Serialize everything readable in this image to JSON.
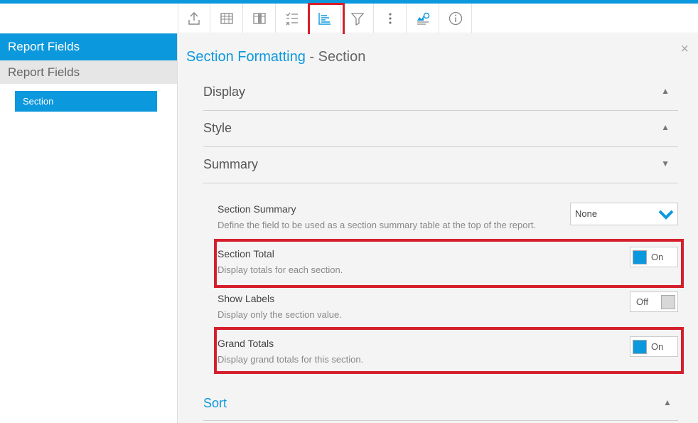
{
  "sidebar": {
    "header": "Report Fields",
    "subheader": "Report Fields",
    "item": "Section"
  },
  "toolbar": {
    "icons": [
      "export-icon",
      "table-icon",
      "columns-icon",
      "checklist-icon",
      "section-format-icon",
      "filter-icon",
      "more-icon",
      "chart-icon",
      "info-icon"
    ],
    "active": "section-format-icon"
  },
  "panel": {
    "title": "Section Formatting",
    "separator": "-",
    "title_suffix": "Section",
    "close": "×",
    "sections": [
      {
        "label": "Display",
        "chevron": "▲"
      },
      {
        "label": "Style",
        "chevron": "▲"
      },
      {
        "label": "Summary",
        "chevron": "▼"
      }
    ],
    "settings": {
      "section_summary": {
        "name": "Section Summary",
        "desc": "Define the field to be used as a section summary table at the top of the report.",
        "value": "None"
      },
      "section_total": {
        "name": "Section Total",
        "desc": "Display totals for each section.",
        "state": "On"
      },
      "show_labels": {
        "name": "Show Labels",
        "desc": "Display only the section value.",
        "state": "Off"
      },
      "grand_totals": {
        "name": "Grand Totals",
        "desc": "Display grand totals for this section.",
        "state": "On"
      }
    },
    "sort": {
      "label": "Sort",
      "chevron": "▲"
    }
  },
  "colors": {
    "accent": "#0c98dd",
    "highlight": "#d51f2c"
  }
}
